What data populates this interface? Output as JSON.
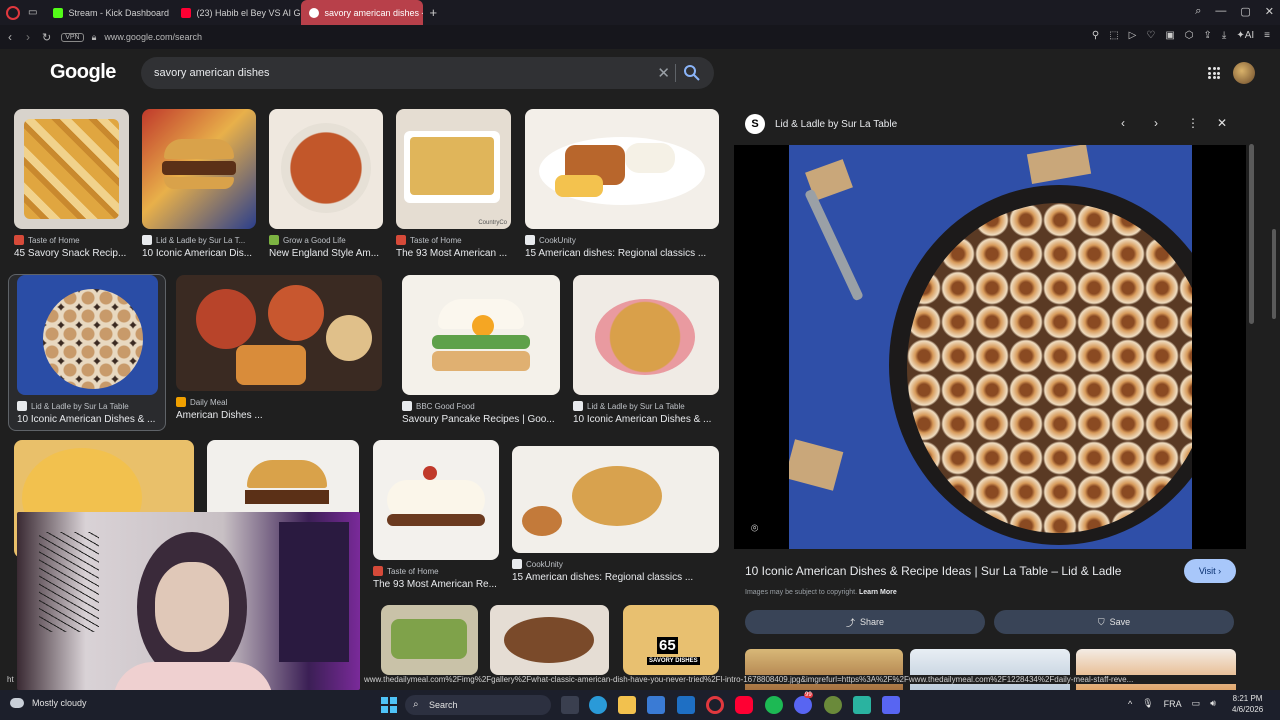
{
  "browser": {
    "tabs": [
      {
        "label": "Stream - Kick Dashboard",
        "color": "#53fc18"
      },
      {
        "label": "(23) Habib el Bey VS AI Gr...",
        "color": "#ff0033"
      },
      {
        "label": "savory american dishes - Go",
        "color": "#ffffff"
      }
    ],
    "new_tab": "+",
    "vpn": "VPN",
    "url": "www.google.com/search",
    "ai_label": "AI"
  },
  "google": {
    "logo": "Google",
    "query": "savory american dishes"
  },
  "results": [
    {
      "source": "Taste of Home",
      "title": "45 Savory Snack Recip...",
      "color": "#d64a39"
    },
    {
      "source": "Lid & Ladle by Sur La T...",
      "title": "10 Iconic American Dis...",
      "color": "#e8eaed"
    },
    {
      "source": "Grow a Good Life",
      "title": "New England Style Am...",
      "color": "#7cb342"
    },
    {
      "source": "Taste of Home",
      "title": "The 93 Most American ...",
      "color": "#d64a39"
    },
    {
      "source": "CookUnity",
      "title": "15 American dishes: Regional classics ...",
      "color": "#e8eaed"
    },
    {
      "source": "Lid & Ladle by Sur La Table",
      "title": "10 Iconic American Dishes & ...",
      "color": "#e8eaed"
    },
    {
      "source": "Daily Meal",
      "title": "American Dishes ...",
      "color": "#f0a000"
    },
    {
      "source": "BBC Good Food",
      "title": "Savoury Pancake Recipes | Goo...",
      "color": "#e8eaed"
    },
    {
      "source": "Lid & Ladle by Sur La Table",
      "title": "10 Iconic American Dishes & ...",
      "color": "#e8eaed"
    },
    {
      "source": "Taste of Home",
      "title": "The 93 Most American Re...",
      "color": "#d64a39"
    },
    {
      "source": "CookUnity",
      "title": "15 American dishes: Regional classics ...",
      "color": "#e8eaed"
    }
  ],
  "thumb_text": {
    "corner": "CountryCo",
    "num": "65",
    "caption": "SAVORY DISHES"
  },
  "panel": {
    "source": "Lid & Ladle by Sur La Table",
    "title": "10 Iconic American Dishes & Recipe Ideas | Sur La Table – Lid & Ladle",
    "visit": "Visit",
    "copyright": "Images may be subject to copyright.",
    "learn_more": "Learn More",
    "share": "Share",
    "save": "Save"
  },
  "status": {
    "left": "ht",
    "url": "www.thedailymeal.com%2Fimg%2Fgallery%2Fwhat-classic-american-dish-have-you-never-tried%2Fl-intro-1678808409.jpg&imgrefurl=https%3A%2F%2Fwww.thedailymeal.com%2F1228434%2Fdaily-meal-staff-reve..."
  },
  "taskbar": {
    "weather": "Mostly cloudy",
    "search": "Search",
    "lang": "FRA",
    "time": "8:21 PM",
    "date": "4/6/2026",
    "badge": "99"
  }
}
